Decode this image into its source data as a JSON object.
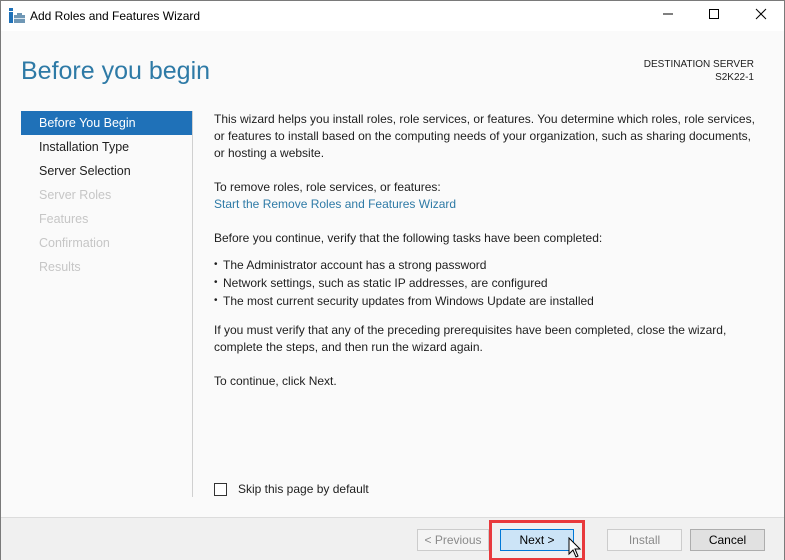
{
  "window": {
    "title": "Add Roles and Features Wizard",
    "icon": "server-manager-icon",
    "controls": {
      "minimize": "minimize-icon",
      "maximize": "maximize-icon",
      "close": "close-icon"
    }
  },
  "header": {
    "page_title": "Before you begin",
    "destination_label": "DESTINATION SERVER",
    "destination_server": "S2K22-1"
  },
  "nav": {
    "items": [
      {
        "label": "Before You Begin",
        "state": "active"
      },
      {
        "label": "Installation Type",
        "state": "enabled"
      },
      {
        "label": "Server Selection",
        "state": "enabled"
      },
      {
        "label": "Server Roles",
        "state": "disabled"
      },
      {
        "label": "Features",
        "state": "disabled"
      },
      {
        "label": "Confirmation",
        "state": "disabled"
      },
      {
        "label": "Results",
        "state": "disabled"
      }
    ]
  },
  "body": {
    "intro": "This wizard helps you install roles, role services, or features. You determine which roles, role services, or features to install based on the computing needs of your organization, such as sharing documents, or hosting a website.",
    "remove_label": "To remove roles, role services, or features:",
    "remove_link": "Start the Remove Roles and Features Wizard",
    "verify_intro": "Before you continue, verify that the following tasks have been completed:",
    "bullets": [
      "The Administrator account has a strong password",
      "Network settings, such as static IP addresses, are configured",
      "The most current security updates from Windows Update are installed"
    ],
    "verify_note": "If you must verify that any of the preceding prerequisites have been completed, close the wizard, complete the steps, and then run the wizard again.",
    "continue_note": "To continue, click Next."
  },
  "skip": {
    "label": "Skip this page by default",
    "checked": false
  },
  "footer": {
    "previous": "< Previous",
    "next": "Next >",
    "install": "Install",
    "cancel": "Cancel"
  },
  "colors": {
    "accent": "#1f71b8",
    "title": "#2e7aa6",
    "highlight": "#e8393c"
  }
}
